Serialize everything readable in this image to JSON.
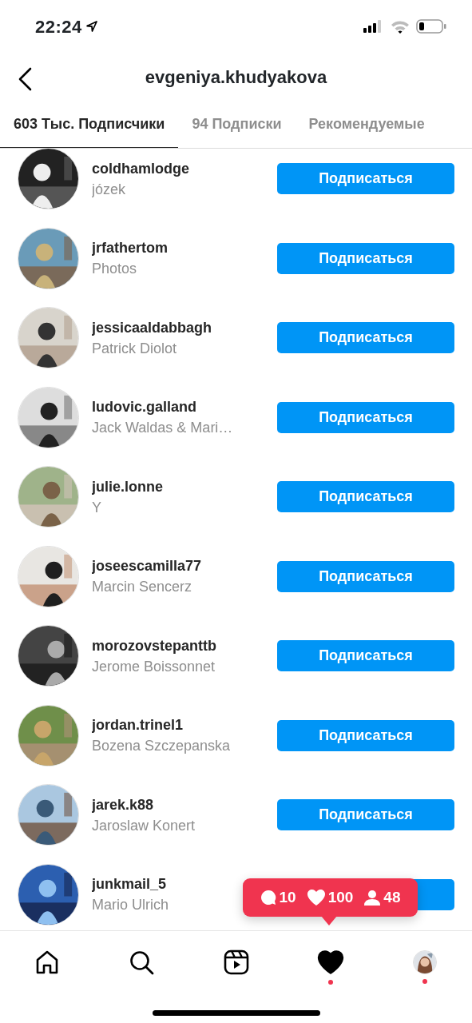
{
  "status_bar": {
    "time": "22:24"
  },
  "header": {
    "title": "evgeniya.khudyakova"
  },
  "tabs": [
    {
      "label": "603 Тыс. Подписчики",
      "selected": true
    },
    {
      "label": "94 Подписки",
      "selected": false
    },
    {
      "label": "Рекомендуемые",
      "selected": false
    }
  ],
  "followers": [
    {
      "username": "coldhamlodge",
      "name": "józek",
      "button": "Подписаться"
    },
    {
      "username": "jrfathertom",
      "name": "Photos",
      "button": "Подписаться"
    },
    {
      "username": "jessicaaldabbagh",
      "name": "Patrick Diolot",
      "button": "Подписаться"
    },
    {
      "username": "ludovic.galland",
      "name": "Jack Waldas & Mari…",
      "button": "Подписаться"
    },
    {
      "username": "julie.lonne",
      "name": "Y",
      "button": "Подписаться"
    },
    {
      "username": "joseescamilla77",
      "name": "Marcin Sencerz",
      "button": "Подписаться"
    },
    {
      "username": "morozovstepanttb",
      "name": "Jerome Boissonnet",
      "button": "Подписаться"
    },
    {
      "username": "jordan.trinel1",
      "name": "Bozena Szczepanska",
      "button": "Подписаться"
    },
    {
      "username": "jarek.k88",
      "name": "Jaroslaw Konert",
      "button": "Подписаться"
    },
    {
      "username": "junkmail_5",
      "name": "Mario Ulrich"
    }
  ],
  "activity_popup": [
    {
      "kind": "comments",
      "count": "10"
    },
    {
      "kind": "likes",
      "count": "100"
    },
    {
      "kind": "followers",
      "count": "48"
    }
  ],
  "bottom_nav": [
    {
      "kind": "home",
      "selected": false,
      "badge_dot": false
    },
    {
      "kind": "search",
      "selected": false,
      "badge_dot": false
    },
    {
      "kind": "reels",
      "selected": false,
      "badge_dot": false
    },
    {
      "kind": "activity",
      "selected": true,
      "badge_dot": true
    },
    {
      "kind": "profile",
      "selected": false,
      "badge_dot": true
    }
  ]
}
